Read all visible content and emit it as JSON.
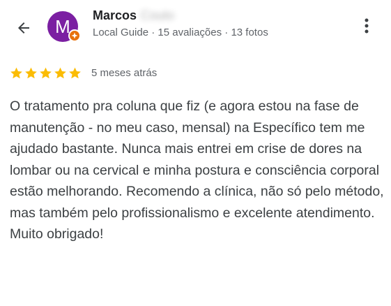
{
  "header": {
    "back_icon": "arrow-back-icon",
    "more_icon": "more-vert-icon"
  },
  "reviewer": {
    "avatar_letter": "M",
    "avatar_color": "#7b1fa2",
    "badge_color": "#e8710a",
    "name": "Marcos",
    "surname_blurred": "Couto",
    "meta": "Local Guide · 15 avaliações · 13 fotos"
  },
  "review": {
    "rating": 5,
    "max_rating": 5,
    "star_color": "#fbbc04",
    "date": "5 meses atrás",
    "text": "O tratamento pra coluna que fiz (e agora estou na fase de manutenção - no meu caso, mensal) na Específico tem me ajudado bastante. Nunca mais entrei em crise de dores na lombar ou na cervical e minha postura e consciência corporal estão melhorando. Recomendo a clínica, não só pelo método, mas também pelo profissionalismo e excelente atendimento. Muito obrigado!"
  }
}
